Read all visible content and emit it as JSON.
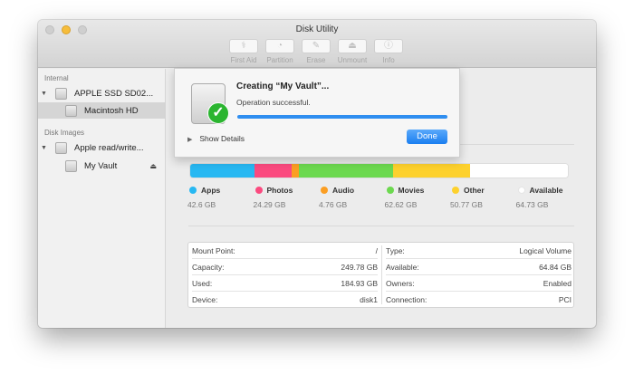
{
  "window": {
    "title": "Disk Utility"
  },
  "toolbar": [
    {
      "label": "First Aid",
      "icon": "stethoscope-icon",
      "glyph": "⚕"
    },
    {
      "label": "Partition",
      "icon": "pie-icon",
      "glyph": "◔"
    },
    {
      "label": "Erase",
      "icon": "erase-icon",
      "glyph": "✎"
    },
    {
      "label": "Unmount",
      "icon": "unmount-icon",
      "glyph": "⏏"
    },
    {
      "label": "Info",
      "icon": "info-icon",
      "glyph": "ⓘ"
    }
  ],
  "sidebar": {
    "internal": "Internal",
    "disk_images": "Disk Images",
    "items": [
      {
        "label": "APPLE SSD SD02..."
      },
      {
        "label": "Macintosh HD"
      },
      {
        "label": "Apple read/write..."
      },
      {
        "label": "My Vault"
      }
    ],
    "eject": "⏏"
  },
  "sheet": {
    "title": "Creating “My Vault”...",
    "message": "Operation successful.",
    "progress": 100,
    "show_details": "Show Details",
    "done": "Done",
    "check": "✓"
  },
  "usage": [
    {
      "name": "Apps",
      "value": "42.6 GB",
      "gb": 42.6,
      "color": "#27b8f2"
    },
    {
      "name": "Photos",
      "value": "24.29 GB",
      "gb": 24.29,
      "color": "#fb4a7f"
    },
    {
      "name": "Audio",
      "value": "4.76 GB",
      "gb": 4.76,
      "color": "#fb9e23"
    },
    {
      "name": "Movies",
      "value": "62.62 GB",
      "gb": 62.62,
      "color": "#6cd94f"
    },
    {
      "name": "Other",
      "value": "50.77 GB",
      "gb": 50.77,
      "color": "#fdd12d"
    },
    {
      "name": "Available",
      "value": "64.73 GB",
      "gb": 64.73,
      "color": "#ffffff"
    }
  ],
  "info": {
    "left": [
      {
        "k": "Mount Point:",
        "v": "/"
      },
      {
        "k": "Capacity:",
        "v": "249.78 GB"
      },
      {
        "k": "Used:",
        "v": "184.93 GB"
      },
      {
        "k": "Device:",
        "v": "disk1"
      }
    ],
    "right": [
      {
        "k": "Type:",
        "v": "Logical Volume"
      },
      {
        "k": "Available:",
        "v": "64.84 GB"
      },
      {
        "k": "Owners:",
        "v": "Enabled"
      },
      {
        "k": "Connection:",
        "v": "PCI"
      }
    ]
  }
}
